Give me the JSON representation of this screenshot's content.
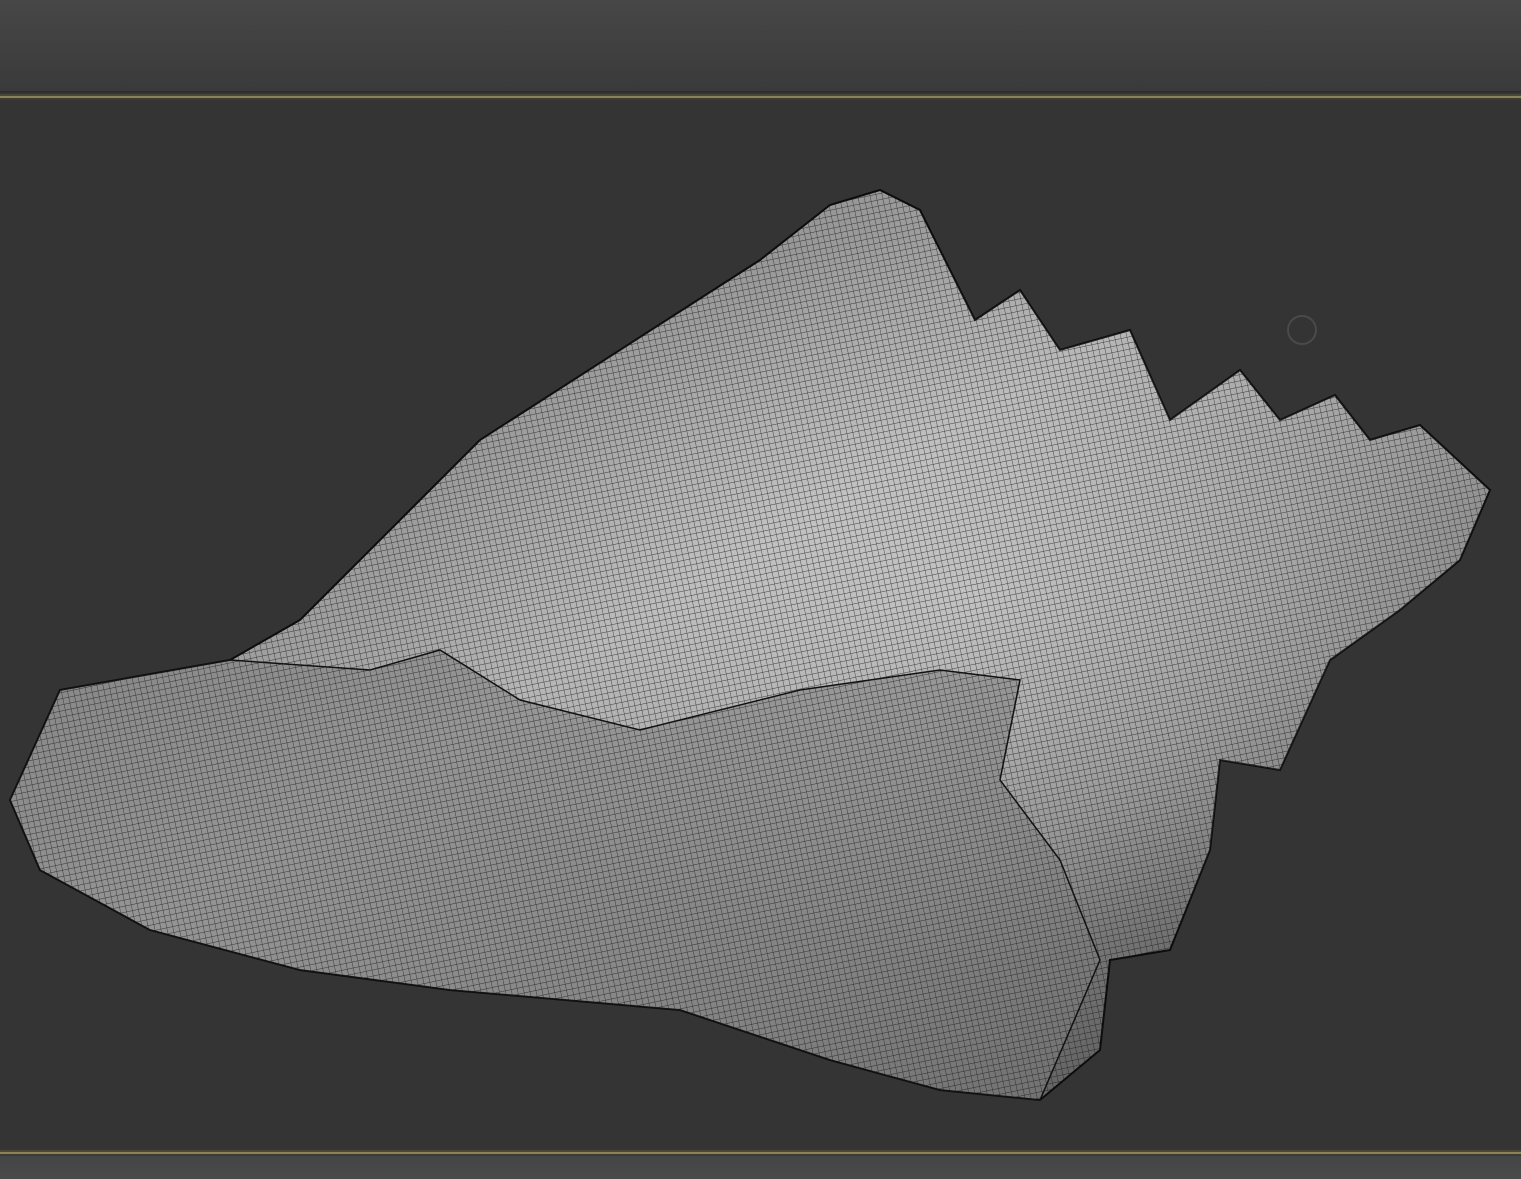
{
  "colors": {
    "viewport_background": "#343434",
    "toolbar": "#444444",
    "active_viewport_border": "#8a8258",
    "mesh_wire": "#1a1a1a",
    "mesh_surface": "#8c8c8c"
  },
  "viewport": {
    "display_mode": "wireframe-on-shaded",
    "object": "seashell mesh"
  },
  "icons": {
    "navigation_gizmo": "circle-gizmo-icon"
  }
}
